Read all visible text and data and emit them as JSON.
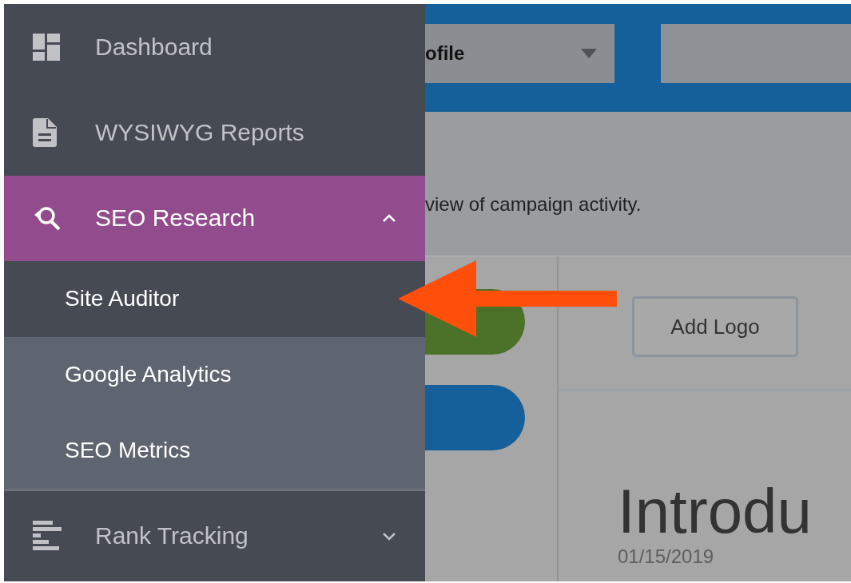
{
  "sidebar": {
    "items": [
      {
        "label": "Dashboard",
        "selected": false
      },
      {
        "label": "WYSIWYG Reports",
        "selected": false
      },
      {
        "label": "SEO Research",
        "selected": true,
        "expanded": true,
        "children": [
          {
            "label": "Site Auditor",
            "selected": true
          },
          {
            "label": "Google Analytics",
            "selected": false
          },
          {
            "label": "SEO Metrics",
            "selected": false
          }
        ]
      },
      {
        "label": "Rank Tracking",
        "selected": false,
        "expanded": false
      }
    ]
  },
  "header": {
    "profile_dropdown": {
      "value": "ofile"
    }
  },
  "description": "view of campaign activity.",
  "add_logo_button": "Add Logo",
  "title": "Introdu",
  "date": "01/15/2019"
}
